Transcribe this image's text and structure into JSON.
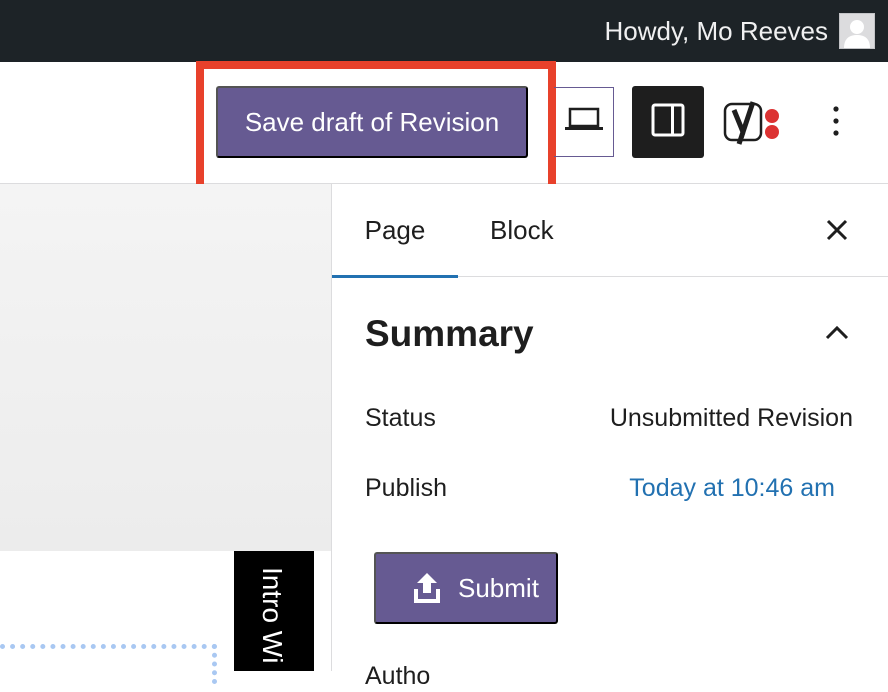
{
  "adminbar": {
    "greeting": "Howdy, Mo Reeves"
  },
  "toolbar": {
    "save_label": "Save draft of Revision",
    "icons": {
      "preview": "laptop-icon",
      "settings": "sidebar-toggle-icon",
      "yoast": "yoast-icon",
      "more": "more-vertical-icon"
    },
    "colors": {
      "primary": "#665a92",
      "highlight": "#e8412b",
      "settings_bg": "#1e1e1e"
    }
  },
  "canvas": {
    "vertical_label": "Intro Wi"
  },
  "sidebar": {
    "tabs": [
      {
        "label": "Page",
        "active": true
      },
      {
        "label": "Block",
        "active": false
      }
    ],
    "summary": {
      "title": "Summary",
      "status_label": "Status",
      "status_value": "Unsubmitted Revision",
      "publish_label": "Publish",
      "publish_value": "Today at 10:46 am",
      "submit_label": "Submit",
      "author_label": "Autho"
    },
    "colors": {
      "link": "#2271b1",
      "tab_indicator": "#2271b1"
    }
  }
}
